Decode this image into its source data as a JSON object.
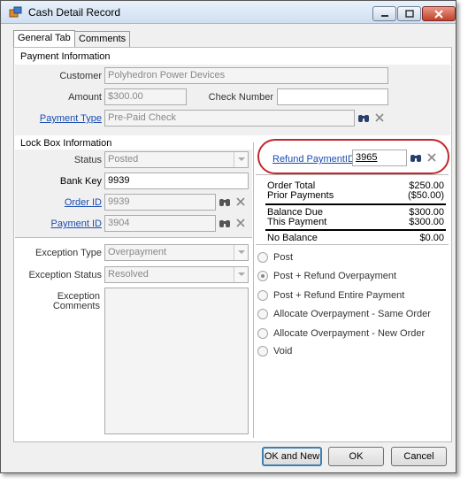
{
  "window": {
    "title": "Cash Detail  Record"
  },
  "tabs": [
    {
      "label": "General Tab",
      "active": true
    },
    {
      "label": "Comments",
      "active": false
    }
  ],
  "payment_info": {
    "heading": "Payment Information",
    "customer_label": "Customer",
    "customer_value": "Polyhedron Power Devices",
    "amount_label": "Amount",
    "amount_value": "$300.00",
    "check_number_label": "Check Number",
    "check_number_value": "",
    "payment_type_label": "Payment Type",
    "payment_type_value": "Pre-Paid Check"
  },
  "lockbox": {
    "heading": "Lock Box Information",
    "status_label": "Status",
    "status_value": "Posted",
    "bank_key_label": "Bank Key",
    "bank_key_value": "9939",
    "order_id_label": "Order ID",
    "order_id_value": "9939",
    "payment_id_label": "Payment ID",
    "payment_id_value": "3904"
  },
  "refund": {
    "label": "Refund PaymentID",
    "value": "3965"
  },
  "summary": {
    "order_total_label": "Order Total",
    "order_total_value": "$250.00",
    "prior_payments_label": "Prior Payments",
    "prior_payments_value": "($50.00)",
    "balance_due_label": "Balance Due",
    "balance_due_value": "$300.00",
    "this_payment_label": "This Payment",
    "this_payment_value": "$300.00",
    "no_balance_label": "No Balance",
    "no_balance_value": "$0.00"
  },
  "exception": {
    "type_label": "Exception Type",
    "type_value": "Overpayment",
    "status_label": "Exception Status",
    "status_value": "Resolved",
    "comments_label_1": "Exception",
    "comments_label_2": "Comments",
    "comments_value": ""
  },
  "options": [
    {
      "label": "Post",
      "checked": false
    },
    {
      "label": "Post + Refund Overpayment",
      "checked": true
    },
    {
      "label": "Post + Refund Entire Payment",
      "checked": false
    },
    {
      "label": "Allocate Overpayment - Same Order",
      "checked": false
    },
    {
      "label": "Allocate Overpayment - New Order",
      "checked": false
    },
    {
      "label": "Void",
      "checked": false
    }
  ],
  "buttons": {
    "ok_and_new": "OK and New",
    "ok": "OK",
    "cancel": "Cancel"
  },
  "colors": {
    "link": "#1a4db3",
    "highlight_ring": "#c0282e"
  }
}
